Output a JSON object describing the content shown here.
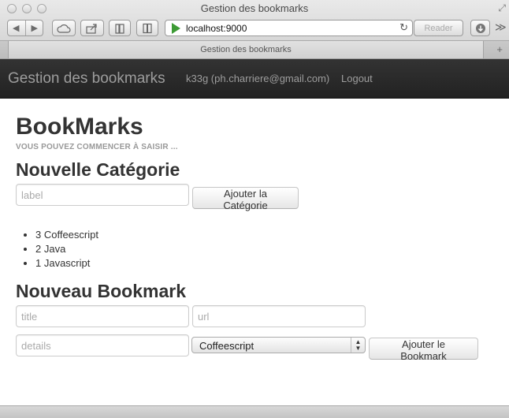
{
  "window": {
    "title": "Gestion des bookmarks"
  },
  "toolbar": {
    "url": "localhost:9000",
    "reader_label": "Reader"
  },
  "tab": {
    "label": "Gestion des bookmarks"
  },
  "navbar": {
    "brand": "Gestion des bookmarks",
    "user": "k33g (ph.charriere@gmail.com)",
    "logout": "Logout"
  },
  "page": {
    "title": "BookMarks",
    "subtitle": "VOUS POUVEZ COMMENCER À SAISIR ..."
  },
  "category_form": {
    "heading": "Nouvelle Catégorie",
    "label_placeholder": "label",
    "add_button": "Ajouter la Catégorie"
  },
  "categories": [
    {
      "label": "3 Coffeescript"
    },
    {
      "label": "2 Java"
    },
    {
      "label": "1 Javascript"
    }
  ],
  "bookmark_form": {
    "heading": "Nouveau Bookmark",
    "title_placeholder": "title",
    "url_placeholder": "url",
    "details_placeholder": "details",
    "category_selected": "Coffeescript",
    "add_button": "Ajouter le Bookmark"
  },
  "icons": {
    "back": "back-icon",
    "forward": "forward-icon",
    "cloud": "cloud-icon",
    "share": "share-icon",
    "bookmarks": "bookmarks-icon",
    "reading_list": "reading-list-icon",
    "go": "go-icon",
    "reload": "reload-icon",
    "downloads": "downloads-icon",
    "more": "more-icon",
    "new_tab": "plus-icon",
    "resize": "resize-icon"
  },
  "colors": {
    "navbar_bg": "#222222",
    "navbar_text": "#9d9d9d",
    "go_icon": "#3d9b35"
  }
}
